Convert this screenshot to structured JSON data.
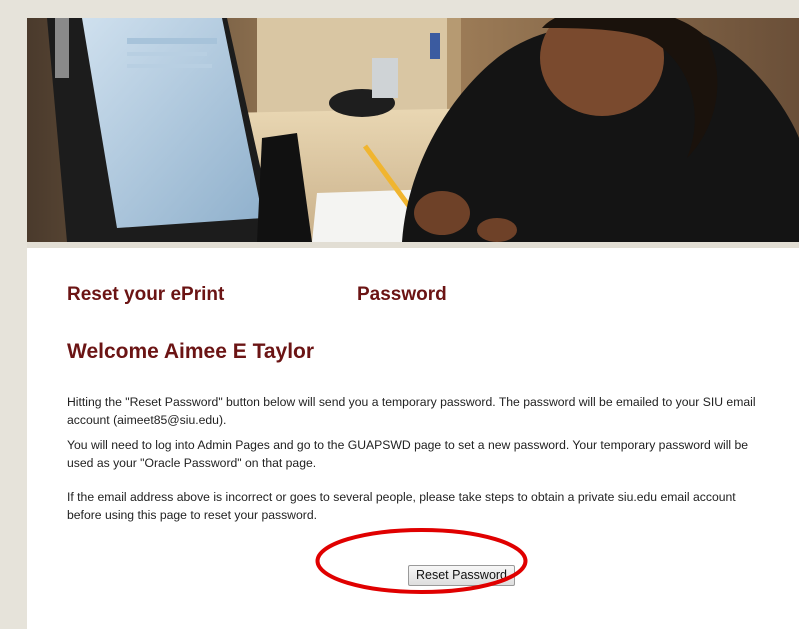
{
  "heading": {
    "left": "Reset your ePrint",
    "right": "Password"
  },
  "welcome": "Welcome Aimee E Taylor",
  "paragraphs": {
    "p1": "Hitting the \"Reset Password\" button below will send you a temporary password. The password will be emailed to your SIU email account (aimeet85@siu.edu).",
    "p2": "You will need to log into Admin Pages and go to the GUAPSWD page to set a new password. Your temporary password will be used as your \"Oracle Password\" on that page.",
    "p3": "If the email address above is incorrect or goes to several people, please take steps to obtain a private siu.edu email account before using this page to reset your password."
  },
  "button": {
    "label": "Reset Password"
  },
  "colors": {
    "heading": "#6b1414",
    "annotation": "#e00000",
    "border_strip": "#e6e3da"
  },
  "hero": {
    "subject": "student-writing-at-computer-desk"
  }
}
